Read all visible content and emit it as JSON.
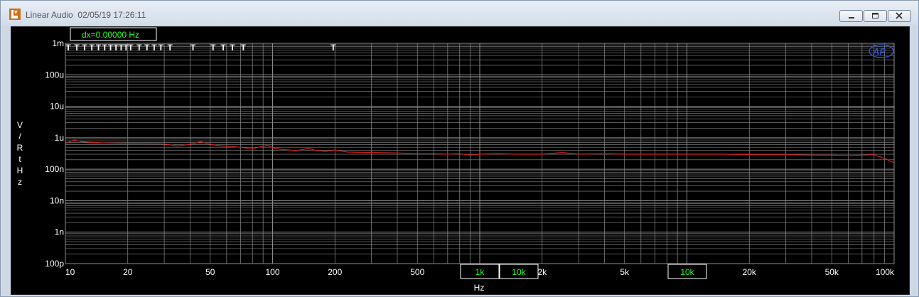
{
  "window": {
    "title": "Linear Audio  02/05/19 17:26:11",
    "app_icon": "linear-audio-logo-icon"
  },
  "controls": {
    "minimize": "minimize-icon",
    "maximize": "maximize-icon",
    "close": "close-icon"
  },
  "colors": {
    "background": "#000000",
    "grid": "#8c8c8c",
    "trace": "#d02020",
    "labels": "#ffffff",
    "readout": "#20ff20"
  },
  "chart_data": {
    "type": "line",
    "xscale": "log",
    "yscale": "log",
    "xlim": [
      10,
      100000
    ],
    "ylim": [
      1e-10,
      0.001
    ],
    "grid": true,
    "xlabel": "Hz",
    "ylabel": "V/RtHz",
    "xticks": [
      {
        "value": 10,
        "label": "10"
      },
      {
        "value": 20,
        "label": "20"
      },
      {
        "value": 50,
        "label": "50"
      },
      {
        "value": 100,
        "label": "100"
      },
      {
        "value": 200,
        "label": "200"
      },
      {
        "value": 500,
        "label": "500"
      },
      {
        "value": 2000,
        "label": "2k"
      },
      {
        "value": 5000,
        "label": "5k"
      },
      {
        "value": 20000,
        "label": "20k"
      },
      {
        "value": 50000,
        "label": "50k"
      },
      {
        "value": 100000,
        "label": "100k"
      }
    ],
    "yticks": [
      {
        "value": 0.001,
        "label": "1m"
      },
      {
        "value": 0.0001,
        "label": "100u"
      },
      {
        "value": 1e-05,
        "label": "10u"
      },
      {
        "value": 1e-06,
        "label": "1u"
      },
      {
        "value": 1e-07,
        "label": "100n"
      },
      {
        "value": 1e-08,
        "label": "10n"
      },
      {
        "value": 1e-09,
        "label": "1n"
      },
      {
        "value": 1e-10,
        "label": "100p"
      }
    ],
    "readout": "dx=0.00000  Hz",
    "band_boxes": [
      "1k",
      "10k",
      "10k"
    ],
    "marker_label": "T",
    "marker_freqs": [
      10,
      11,
      12,
      13,
      14,
      15,
      16,
      17,
      18,
      19,
      20,
      22,
      24,
      26,
      28,
      31,
      40,
      50,
      56,
      62,
      70,
      190
    ],
    "series": [
      {
        "x": [
          10,
          11,
          12,
          13,
          15,
          17,
          20,
          25,
          30,
          35,
          40,
          45,
          48,
          55,
          65,
          80,
          95,
          100,
          110,
          130,
          150,
          160,
          180,
          200,
          230,
          300,
          400,
          500,
          600,
          700,
          800,
          900,
          1000,
          1200,
          1500,
          2000,
          2500,
          3000,
          4000,
          5000,
          7000,
          10000,
          15000,
          20000,
          30000,
          40000,
          50000,
          60000,
          70000,
          80000,
          90000,
          100000
        ],
        "y": [
          6.5e-07,
          8.5e-07,
          7.5e-07,
          7.2e-07,
          6.9e-07,
          6.8e-07,
          6.7e-07,
          6.6e-07,
          6.3e-07,
          5.5e-07,
          6.2e-07,
          7.5e-07,
          6.5e-07,
          5.6e-07,
          5.2e-07,
          4.5e-07,
          5.8e-07,
          4.8e-07,
          4.3e-07,
          3.9e-07,
          4.6e-07,
          4e-07,
          3.7e-07,
          4.1e-07,
          3.5e-07,
          3.4e-07,
          3.3e-07,
          3.1e-07,
          3.1e-07,
          3e-07,
          3.1e-07,
          2.8e-07,
          3e-07,
          3.1e-07,
          3e-07,
          3e-07,
          3.4e-07,
          3e-07,
          3.1e-07,
          3e-07,
          3e-07,
          3e-07,
          3e-07,
          2.9e-07,
          2.9e-07,
          2.8e-07,
          2.8e-07,
          2.7e-07,
          2.8e-07,
          2.9e-07,
          2.2e-07,
          1.6e-07
        ]
      }
    ]
  }
}
